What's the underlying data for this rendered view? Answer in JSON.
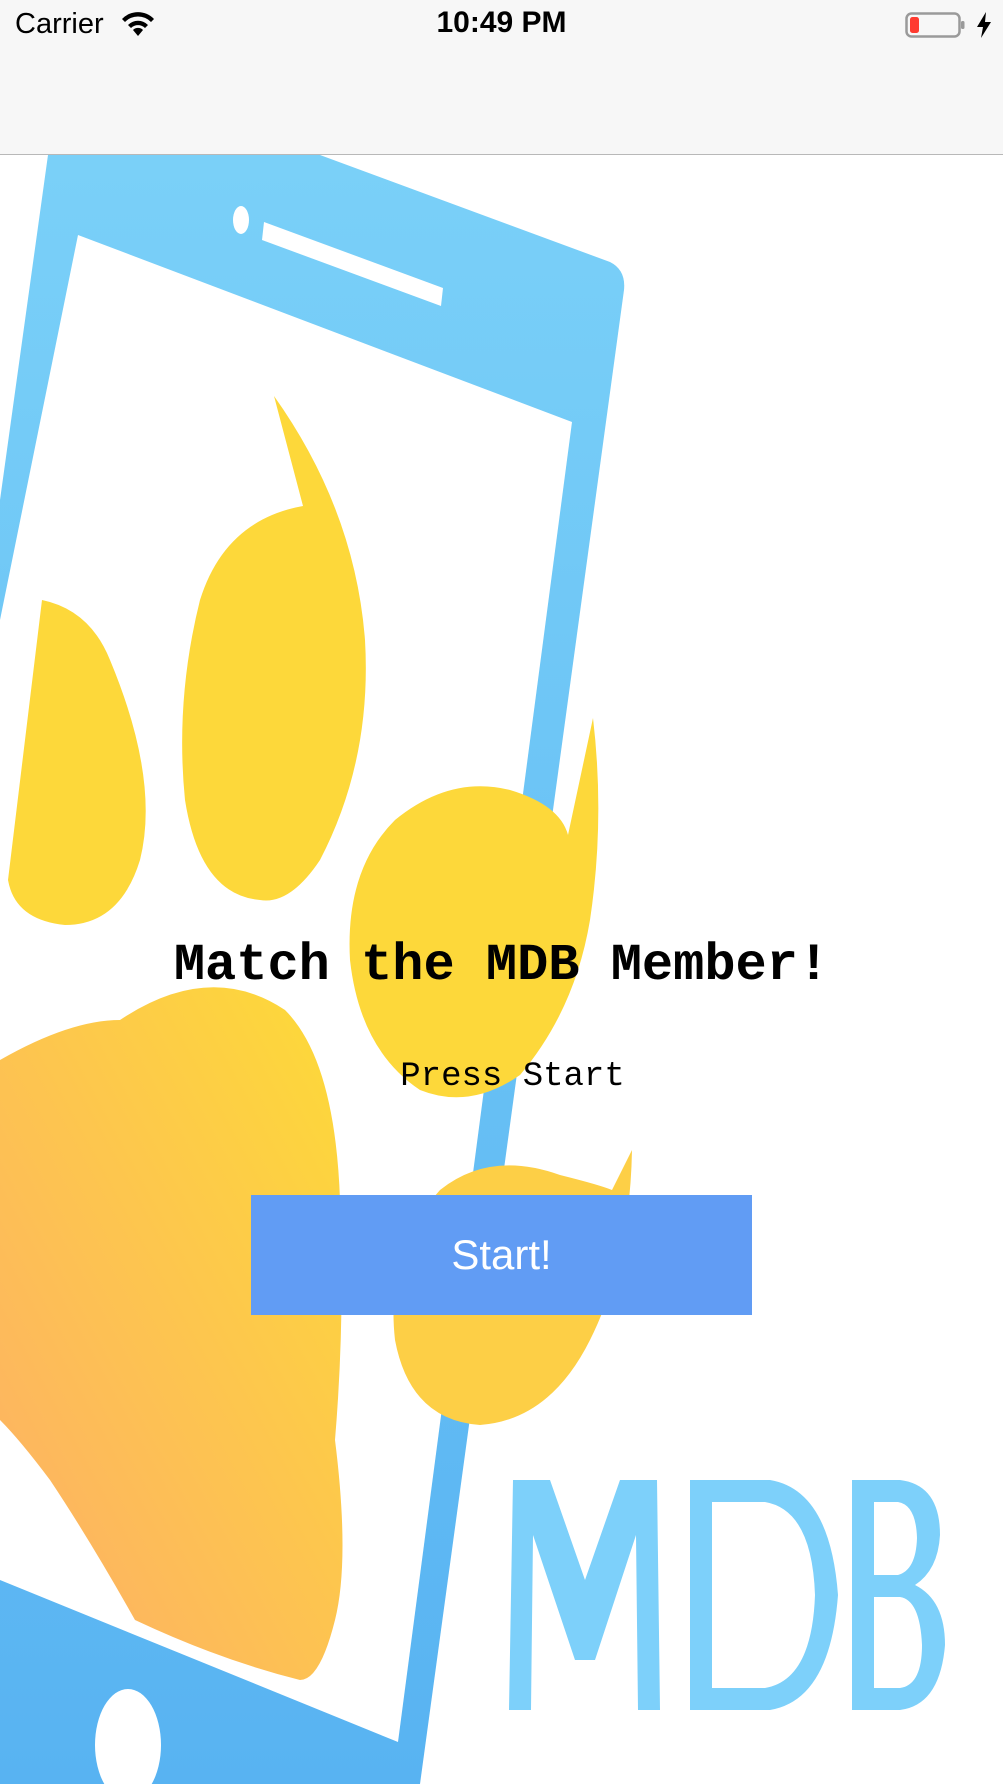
{
  "status_bar": {
    "carrier": "Carrier",
    "time": "10:49 PM",
    "icons": [
      "wifi-icon",
      "battery-low-icon",
      "charging-bolt-icon"
    ],
    "battery_level": 0.15
  },
  "background": {
    "logo_text": "MDB",
    "colors": {
      "phone_blue": "#5bbcf5",
      "paw_yellow": "#fdd83a",
      "paw_orange": "#fdb065",
      "logo_blue": "#7dd0fa"
    }
  },
  "main": {
    "title": "Match the MDB Member!",
    "subtitle": "Press Start",
    "start_button_label": "Start!",
    "button_color": "#619cf4"
  }
}
